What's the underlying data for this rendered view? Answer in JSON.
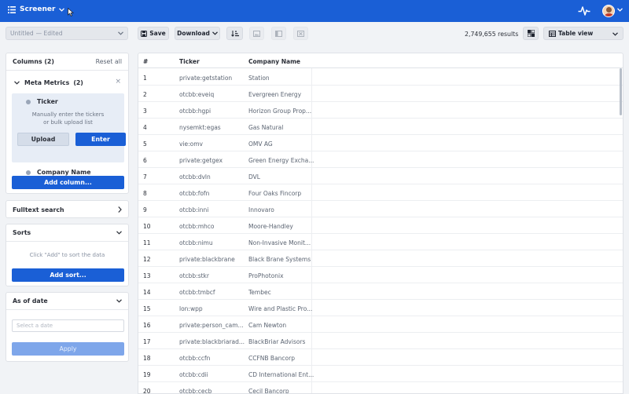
{
  "topbar": {
    "title": "Screener",
    "icons": [
      "filter-list-icon",
      "chevron-down-icon",
      "pulse-icon",
      "avatar",
      "chevron-down-icon"
    ]
  },
  "toolbar": {
    "screen_name": "Untitled",
    "edited_label": "— Edited",
    "save_label": "Save",
    "download_label": "Download",
    "results_count": "2,749,655 results",
    "view_label": "Table view"
  },
  "columns_panel": {
    "title": "Columns (2)",
    "reset_label": "Reset all",
    "group_label": "Meta Metrics",
    "group_count": "(2)",
    "ticker_label": "Ticker",
    "ticker_help_1": "Manually enter the tickers",
    "ticker_help_2": "or bulk upload list",
    "upload_label": "Upload",
    "enter_label": "Enter",
    "company_label": "Company Name",
    "add_column_label": "Add column..."
  },
  "fulltext_panel": {
    "title": "Fulltext search"
  },
  "sorts_panel": {
    "title": "Sorts",
    "empty_note": "Click \"Add\" to sort the data",
    "add_sort_label": "Add sort..."
  },
  "date_panel": {
    "title": "As of date",
    "placeholder": "Select a date",
    "apply_label": "Apply"
  },
  "table": {
    "headers": [
      "#",
      "Ticker",
      "Company Name"
    ],
    "rows": [
      {
        "n": "1",
        "ticker": "private:getstation",
        "company": "Station"
      },
      {
        "n": "2",
        "ticker": "otcbb:eveiq",
        "company": "Evergreen Energy"
      },
      {
        "n": "3",
        "ticker": "otcbb:hgpi",
        "company": "Horizon Group Prop..."
      },
      {
        "n": "4",
        "ticker": "nysemkt:egas",
        "company": "Gas Natural"
      },
      {
        "n": "5",
        "ticker": "vie:omv",
        "company": "OMV AG"
      },
      {
        "n": "6",
        "ticker": "private:getgex",
        "company": "Green Energy Excha..."
      },
      {
        "n": "7",
        "ticker": "otcbb:dvln",
        "company": "DVL"
      },
      {
        "n": "8",
        "ticker": "otcbb:fofn",
        "company": "Four Oaks Fincorp"
      },
      {
        "n": "9",
        "ticker": "otcbb:inni",
        "company": "Innovaro"
      },
      {
        "n": "10",
        "ticker": "otcbb:mhco",
        "company": "Moore-Handley"
      },
      {
        "n": "11",
        "ticker": "otcbb:nimu",
        "company": "Non-Invasive Monit..."
      },
      {
        "n": "12",
        "ticker": "private:blackbrane",
        "company": "Black Brane Systems"
      },
      {
        "n": "13",
        "ticker": "otcbb:stkr",
        "company": "ProPhotonix"
      },
      {
        "n": "14",
        "ticker": "otcbb:tmbcf",
        "company": "Tembec"
      },
      {
        "n": "15",
        "ticker": "lon:wpp",
        "company": "Wire and Plastic Pro..."
      },
      {
        "n": "16",
        "ticker": "private:person_cam...",
        "company": "Cam Newton"
      },
      {
        "n": "17",
        "ticker": "private:blackbriarad...",
        "company": "BlackBriar Advisors"
      },
      {
        "n": "18",
        "ticker": "otcbb:ccfn",
        "company": "CCFNB Bancorp"
      },
      {
        "n": "19",
        "ticker": "otcbb:cdii",
        "company": "CD International Ent..."
      },
      {
        "n": "20",
        "ticker": "otcbb:cecb",
        "company": "Cecil Bancorp"
      }
    ]
  },
  "colors": {
    "brand": "#1a5fd6",
    "background": "#f1f3f6"
  }
}
